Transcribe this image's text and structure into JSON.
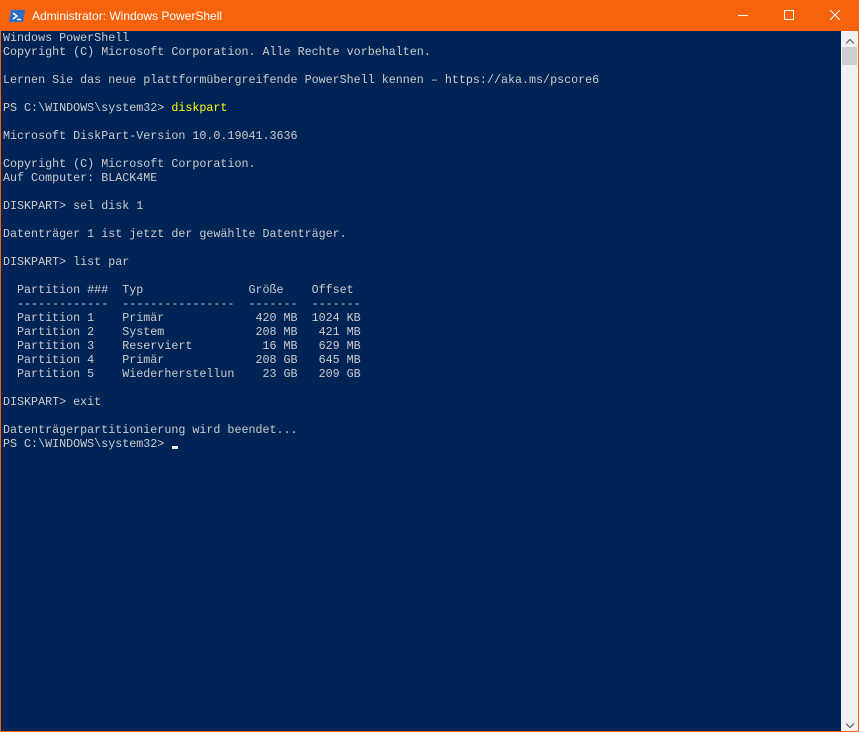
{
  "window": {
    "title": "Administrator: Windows PowerShell",
    "icon": "powershell-icon",
    "controls": {
      "minimize": "minimize-icon",
      "maximize": "maximize-icon",
      "close": "close-icon"
    }
  },
  "console": {
    "intro": {
      "l1": "Windows PowerShell",
      "l2": "Copyright (C) Microsoft Corporation. Alle Rechte vorbehalten.",
      "l3": "Lernen Sie das neue plattformübergreifende PowerShell kennen – https://aka.ms/pscore6"
    },
    "prompt1": "PS C:\\WINDOWS\\system32> ",
    "command1": "diskpart",
    "diskpart": {
      "version": "Microsoft DiskPart-Version 10.0.19041.3636",
      "copyright": "Copyright (C) Microsoft Corporation.",
      "computer": "Auf Computer: BLACK4ME",
      "cmd_sel": "DISKPART> sel disk 1",
      "sel_result": "Datenträger 1 ist jetzt der gewählte Datenträger.",
      "cmd_list": "DISKPART> list par",
      "table_header": "  Partition ###  Typ               Größe    Offset",
      "table_sep": "  -------------  ----------------  -------  -------",
      "rows": [
        "  Partition 1    Primär             420 MB  1024 KB",
        "  Partition 2    System             208 MB   421 MB",
        "  Partition 3    Reserviert          16 MB   629 MB",
        "  Partition 4    Primär             208 GB   645 MB",
        "  Partition 5    Wiederherstellun    23 GB   209 GB"
      ],
      "cmd_exit": "DISKPART> exit",
      "exit_msg": "Datenträgerpartitionierung wird beendet..."
    },
    "prompt2": "PS C:\\WINDOWS\\system32> "
  },
  "colors": {
    "background": "#012456",
    "text": "#cccccc",
    "command": "#ffff00",
    "titlebar": "#f7630c"
  }
}
